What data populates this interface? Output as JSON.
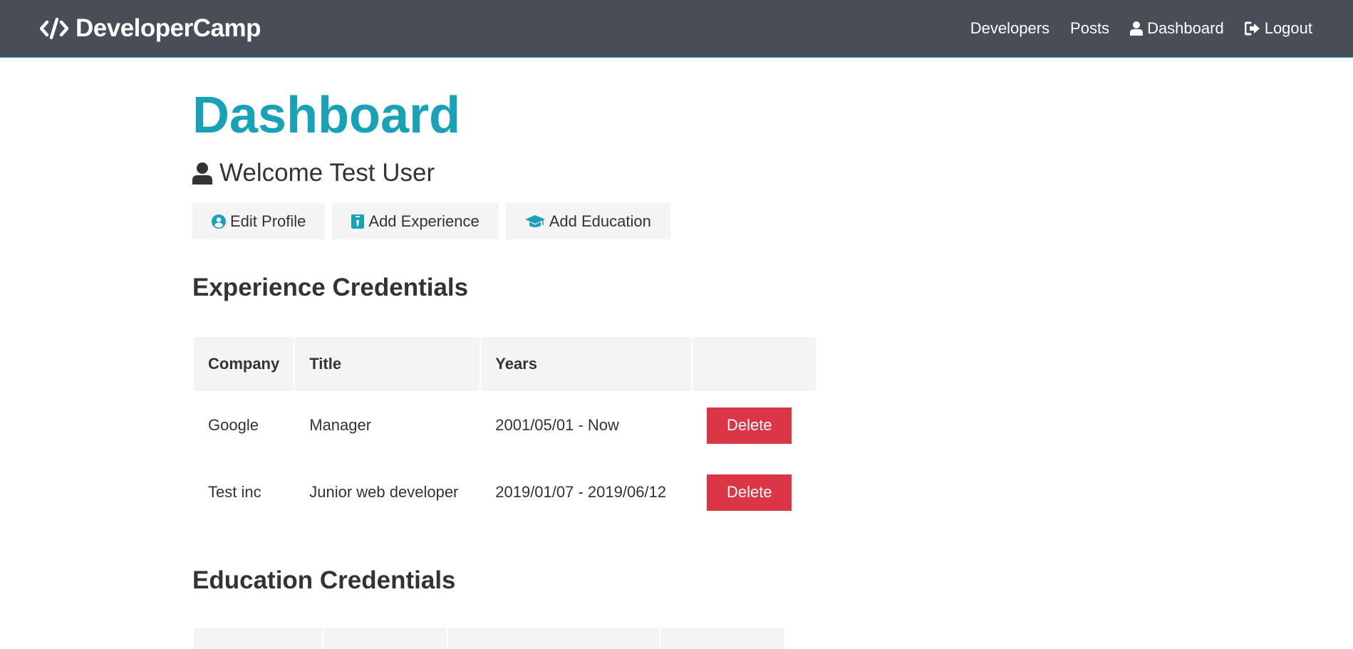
{
  "navbar": {
    "brand": "DeveloperCamp",
    "links": [
      {
        "label": "Developers"
      },
      {
        "label": "Posts"
      },
      {
        "label": "Dashboard",
        "icon": "user-icon"
      },
      {
        "label": "Logout",
        "icon": "sign-out-icon"
      }
    ]
  },
  "main": {
    "title": "Dashboard",
    "welcome": "Welcome Test User",
    "buttons": {
      "edit_profile": "Edit Profile",
      "add_experience": "Add Experience",
      "add_education": "Add Education"
    },
    "experience": {
      "heading": "Experience Credentials",
      "columns": [
        "Company",
        "Title",
        "Years",
        ""
      ],
      "rows": [
        {
          "company": "Google",
          "title": "Manager",
          "years": "2001/05/01 - Now",
          "action": "Delete"
        },
        {
          "company": "Test inc",
          "title": "Junior web developer",
          "years": "2019/01/07 - 2019/06/12",
          "action": "Delete"
        }
      ]
    },
    "education": {
      "heading": "Education Credentials"
    }
  },
  "colors": {
    "navbar_bg": "#494e56",
    "primary": "#17a2b8",
    "danger": "#dc3545",
    "light": "#f4f4f4",
    "text": "#333333"
  }
}
